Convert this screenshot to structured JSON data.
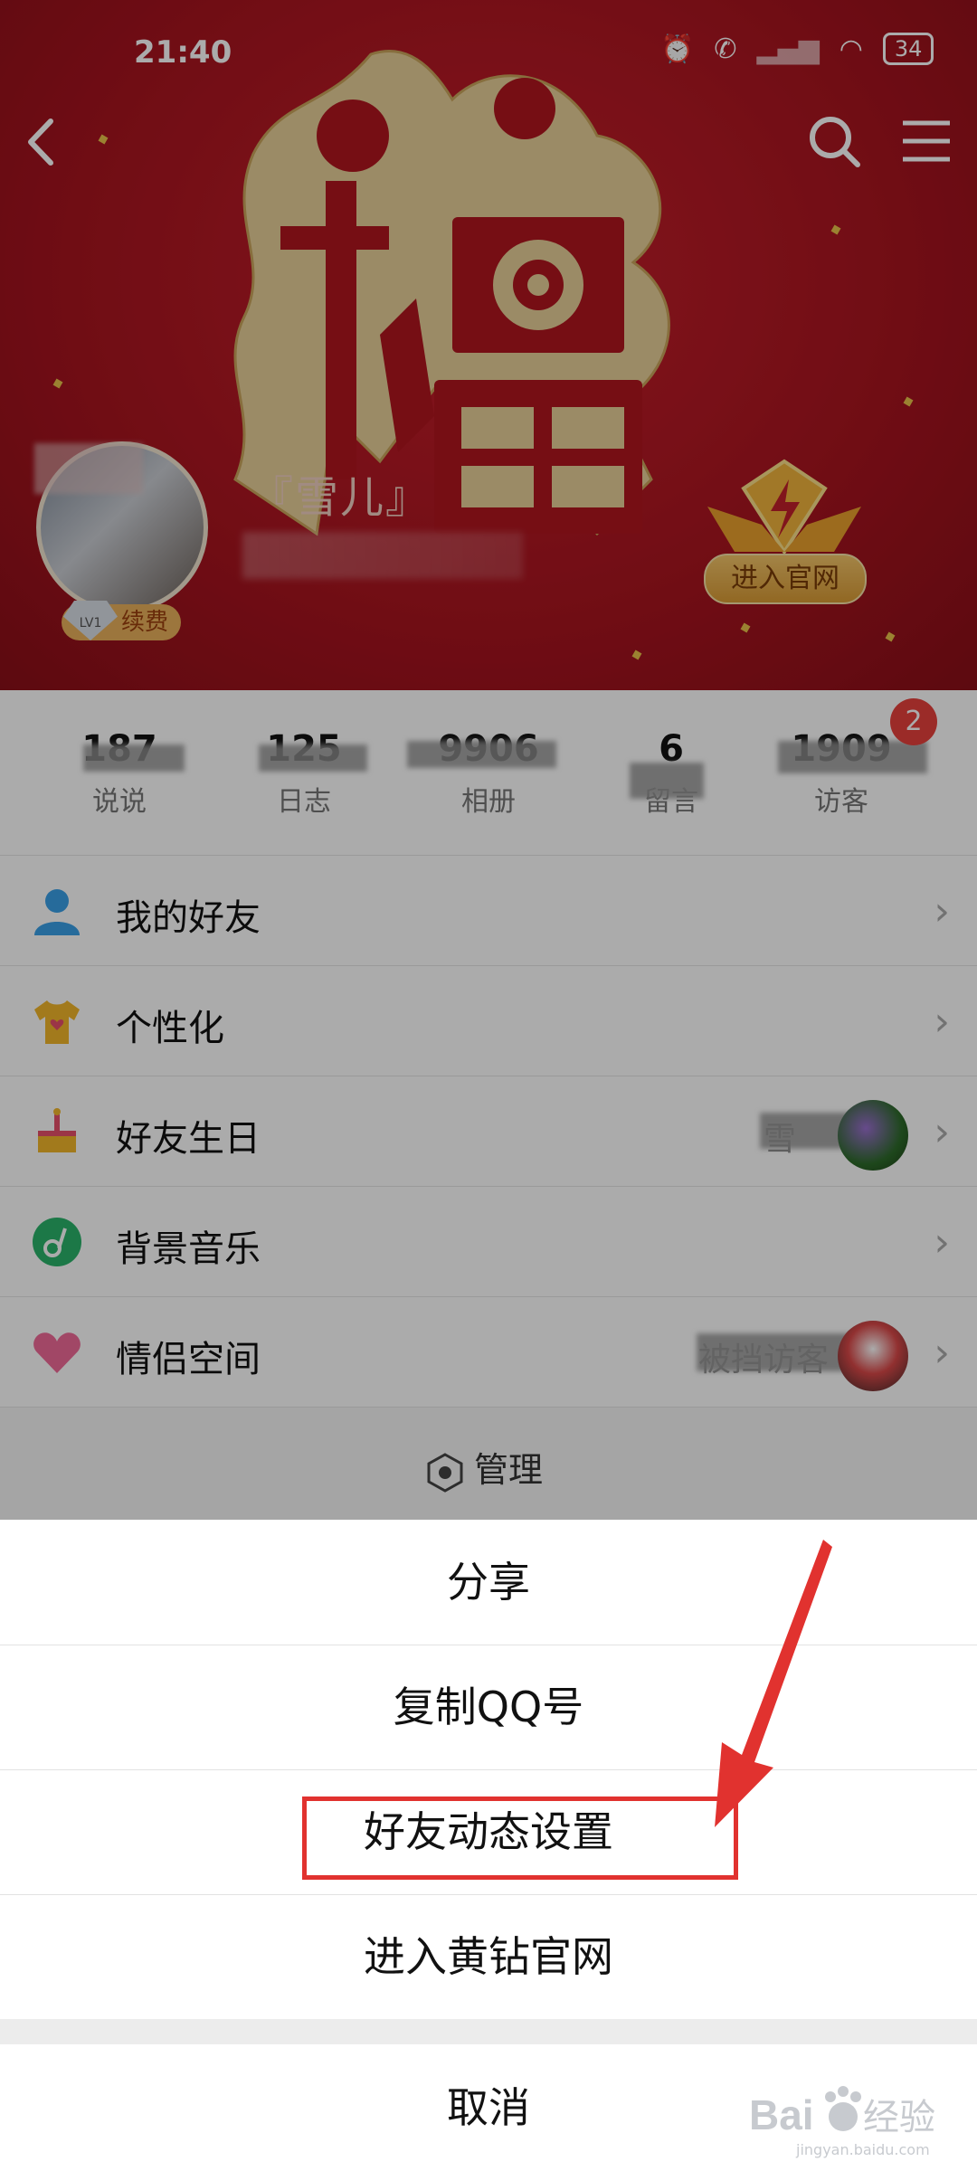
{
  "status_bar": {
    "time": "21:40",
    "battery": "34"
  },
  "header": {
    "nickname": "『雪儿』",
    "level": "LV1",
    "renew_label": "续费",
    "official_site_label": "进入官网",
    "background_art": "red-fu-paper-cut"
  },
  "stats": {
    "items": [
      {
        "value": "187",
        "label": "说说"
      },
      {
        "value": "125",
        "label": "日志"
      },
      {
        "value": "9906",
        "label": "相册"
      },
      {
        "value": "6",
        "label": "留言"
      },
      {
        "value": "1909",
        "label": "访客"
      }
    ],
    "visitor_badge": "2"
  },
  "menu": {
    "items": [
      {
        "label": "我的好友",
        "icon": "friend-icon"
      },
      {
        "label": "个性化",
        "icon": "tshirt-icon"
      },
      {
        "label": "好友生日",
        "icon": "cake-icon",
        "extra": "雪"
      },
      {
        "label": "背景音乐",
        "icon": "music-icon"
      },
      {
        "label": "情侣空间",
        "icon": "heart-icon",
        "extra": "被挡访客"
      }
    ],
    "manage_label": "管理"
  },
  "sheet": {
    "options": [
      "分享",
      "复制QQ号",
      "好友动态设置",
      "进入黄钻官网"
    ],
    "cancel_label": "取消"
  },
  "watermark": {
    "text": "Bai经验",
    "sub": "jingyan.baidu.com"
  },
  "colors": {
    "header_red": "#b0151f",
    "highlight": "#e1322f",
    "gold": "#e9b15b",
    "badge_red": "#e8403c"
  }
}
